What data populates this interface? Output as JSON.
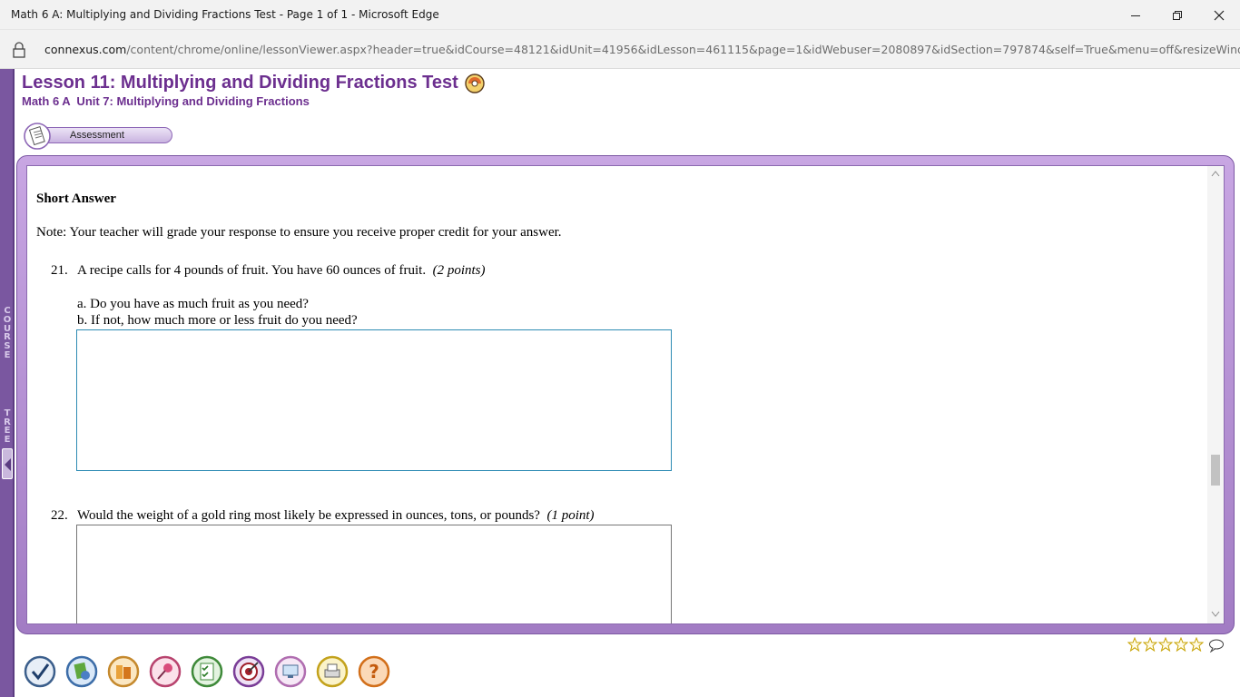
{
  "window": {
    "title": "Math 6 A: Multiplying and Dividing Fractions Test - Page 1 of 1 - Microsoft Edge"
  },
  "address": {
    "domain": "connexus.com",
    "path": "/content/chrome/online/lessonViewer.aspx?header=true&idCourse=48121&idUnit=41956&idLesson=461115&page=1&idWebuser=2080897&idSection=797874&self=True&menu=off&resizeWindow=true"
  },
  "course_tree": {
    "letters": "COURSE TREE"
  },
  "lesson": {
    "title": "Lesson 11: Multiplying and Dividing Fractions Test",
    "subtitle": "Math 6 A  Unit 7: Multiplying and Dividing Fractions",
    "tab_label": "Assessment"
  },
  "section": {
    "heading": "Short Answer",
    "note": "Note: Your teacher will grade your response to ensure you receive proper credit for your answer."
  },
  "questions": [
    {
      "number": "21.",
      "text": "A recipe calls for 4 pounds of fruit. You have 60 ounces of fruit.",
      "points": "(2 points)",
      "parts": [
        "a. Do you have as much fruit as you need?",
        "b. If not, how much more or less fruit do you need?"
      ],
      "answer": ""
    },
    {
      "number": "22.",
      "text": "Would the weight of a gold ring most likely be expressed in ounces, tons, or pounds?",
      "points": "(1 point)",
      "answer": ""
    }
  ],
  "toolbar": {
    "icons": [
      "checkmark-icon",
      "globe-book-icon",
      "books-icon",
      "pushpin-icon",
      "checklist-icon",
      "target-icon",
      "screen-icon",
      "printer-icon",
      "help-icon"
    ]
  },
  "rating": {
    "stars_total": 5,
    "stars_filled": 0
  }
}
